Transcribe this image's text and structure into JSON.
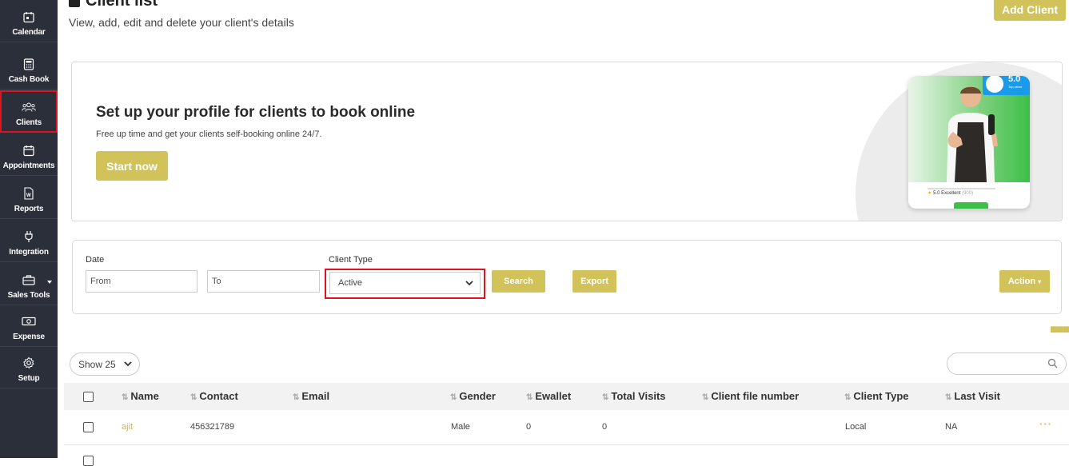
{
  "sidebar": {
    "items": [
      {
        "label": "Calendar",
        "icon": "calendar-icon"
      },
      {
        "label": "Cash Book",
        "icon": "calculator-icon"
      },
      {
        "label": "Clients",
        "icon": "users-icon"
      },
      {
        "label": "Appointments",
        "icon": "calendar-icon"
      },
      {
        "label": "Reports",
        "icon": "document-icon"
      },
      {
        "label": "Integration",
        "icon": "plug-icon"
      },
      {
        "label": "Sales Tools",
        "icon": "briefcase-icon"
      },
      {
        "label": "Expense",
        "icon": "cash-icon"
      },
      {
        "label": "Setup",
        "icon": "gear-icon"
      }
    ],
    "active": "Clients"
  },
  "header": {
    "title": "Client list",
    "subtitle": "View, add, edit and delete your client's details",
    "add_button": "Add Client"
  },
  "banner": {
    "heading": "Set up your profile for clients to book online",
    "text": "Free up time and get your clients self-booking online 24/7.",
    "button": "Start now",
    "rating_value": "5.0",
    "rating_caption": "Top-rated",
    "excellent_label": "5.0 Excellent",
    "excellent_extra": "(900)"
  },
  "filter": {
    "date_label": "Date",
    "from_placeholder": "From",
    "to_placeholder": "To",
    "client_type_label": "Client Type",
    "client_type_value": "Active",
    "search_button": "Search",
    "export_button": "Export",
    "action_button": "Action"
  },
  "table_controls": {
    "show_label": "Show 25"
  },
  "table": {
    "columns": [
      "Name",
      "Contact",
      "Email",
      "Gender",
      "Ewallet",
      "Total Visits",
      "Client file number",
      "Client Type",
      "Last Visit"
    ],
    "rows": [
      {
        "name": "ajit",
        "contact": "456321789",
        "email": "",
        "gender": "Male",
        "ewallet": "0",
        "total_visits": "0",
        "file_number": "",
        "client_type": "Local",
        "last_visit": "NA"
      }
    ]
  },
  "colors": {
    "accent": "#d2c25a",
    "sidebar_bg": "#2b2f3a",
    "highlight": "#e0141e"
  }
}
